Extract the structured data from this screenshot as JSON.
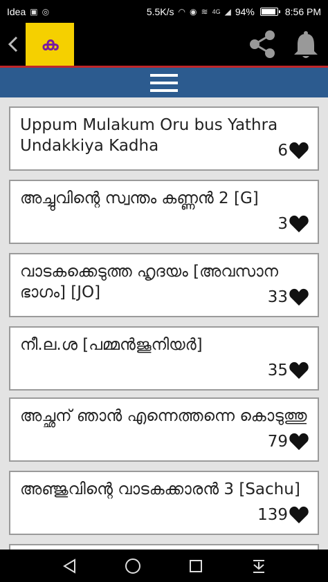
{
  "status_bar": {
    "carrier": "Idea",
    "speed": "5.5K/s",
    "network": "4G",
    "battery": "94%",
    "battery_level": 0.94,
    "time": "8:56 PM"
  },
  "app_bar": {
    "logo_text": "ക"
  },
  "stories": [
    {
      "title": "Uppum Mulakum Oru bus Yathra Undakkiya Kadha",
      "likes": "6"
    },
    {
      "title": "അച്ചുവിന്റെ സ്വന്തം കണ്ണൻ 2 [G]",
      "likes": "3"
    },
    {
      "title": "വാടകക്കെടുത്ത ഹൃദയം [അവസാന ഭാഗം] [JO]",
      "likes": "33"
    },
    {
      "title": "നീ.ല.ശ [പമ്മൻജൂനിയർ]",
      "likes": "35"
    },
    {
      "title": "അച്ഛന് ഞാൻ എന്നെത്തന്നെ കൊടുത്തു",
      "likes": "79"
    },
    {
      "title": "അഞ്ജുവിന്റെ വാടകക്കാരൻ 3 [Sachu]",
      "likes": "139"
    }
  ],
  "colors": {
    "menu_bar": "#2c5b8f",
    "accent_line": "#c0262a",
    "logo_bg": "#f5d000",
    "logo_fg": "#7a1aa0"
  }
}
